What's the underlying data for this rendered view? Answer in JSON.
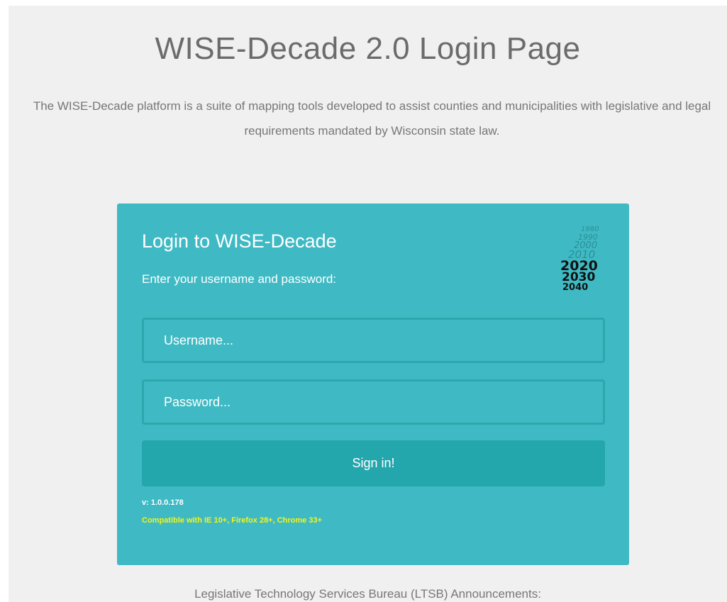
{
  "header": {
    "title": "WISE-Decade 2.0 Login Page",
    "description": "The WISE-Decade platform is a suite of mapping tools developed to assist counties and municipalities with legislative and legal requirements mandated by Wisconsin state law."
  },
  "login": {
    "title": "Login to WISE-Decade",
    "subtitle": "Enter your username and password:",
    "username_placeholder": "Username...",
    "password_placeholder": "Password...",
    "sign_in_label": "Sign in!",
    "version": "v: 1.0.0.178",
    "compatibility": "Compatible with IE 10+, Firefox 28+, Chrome 33+",
    "logo_years": [
      "1980",
      "1990",
      "2000",
      "2010",
      "2020",
      "2030",
      "2040"
    ]
  },
  "footer": {
    "announcements": "Legislative Technology Services Bureau (LTSB) Announcements:"
  },
  "colors": {
    "panel": "#3fbac4",
    "button": "#24a6ad",
    "input_border": "#2ea6ae",
    "compat_text": "#f4f41a",
    "page_bg": "#f0f0f0"
  }
}
